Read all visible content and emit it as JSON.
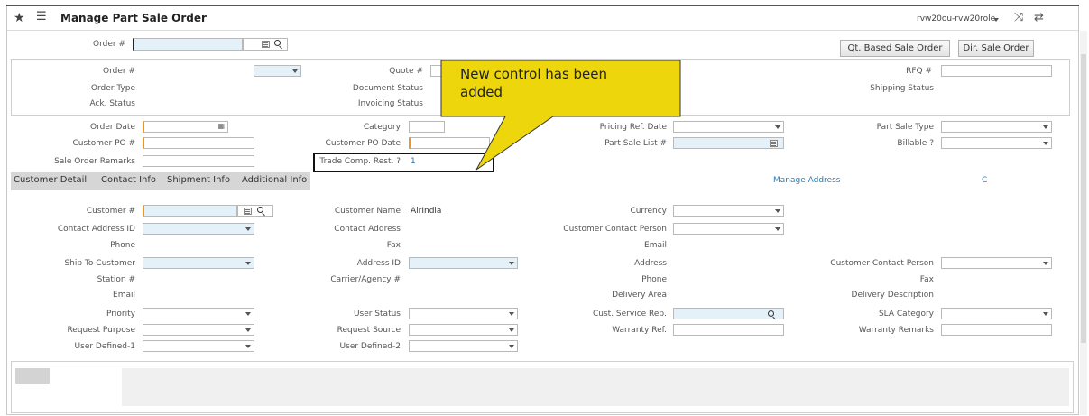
{
  "header": {
    "title": "Manage Part Sale Order",
    "user_role": "rvw20ou-rvw20role"
  },
  "toolbar": {
    "order_label": "Order #",
    "qt_button": "Qt. Based Sale Order",
    "dir_button": "Dir. Sale Order"
  },
  "status_panel": {
    "order_label": "Order #",
    "quote_label": "Quote #",
    "rfq_label": "RFQ #",
    "order_type_label": "Order Type",
    "doc_status_label": "Document Status",
    "shipping_status_label": "Shipping Status",
    "ack_status_label": "Ack. Status",
    "invoicing_status_label": "Invoicing Status"
  },
  "callout": {
    "text_line1": "New control has been",
    "text_line2": "added"
  },
  "order_form": {
    "order_date_label": "Order Date",
    "category_label": "Category",
    "pricing_ref_date_label": "Pricing Ref. Date",
    "part_sale_type_label": "Part Sale Type",
    "customer_po_label": "Customer PO #",
    "customer_po_date_label": "Customer PO Date",
    "part_sale_list_label": "Part Sale List #",
    "billable_label": "Billable ?",
    "remarks_label": "Sale Order Remarks",
    "trade_comp_label": "Trade Comp. Rest. ?",
    "trade_comp_value": "1"
  },
  "tabs": [
    "Customer Detail",
    "Contact Info",
    "Shipment Info",
    "Additional Info"
  ],
  "links": {
    "manage_address": "Manage Address",
    "c": "C"
  },
  "customer": {
    "customer_label": "Customer #",
    "customer_name_label": "Customer Name",
    "customer_name_value": "AirIndia",
    "currency_label": "Currency",
    "contact_address_id_label": "Contact Address ID",
    "contact_address_label": "Contact Address",
    "customer_contact_person_label": "Customer Contact Person",
    "phone_label": "Phone",
    "fax_label": "Fax",
    "email_label": "Email",
    "ship_to_customer_label": "Ship To Customer",
    "address_id_label": "Address ID",
    "address_label": "Address",
    "customer_contact_person2_label": "Customer Contact Person",
    "station_label": "Station #",
    "carrier_label": "Carrier/Agency #",
    "phone2_label": "Phone",
    "fax2_label": "Fax",
    "email2_label": "Email",
    "delivery_area_label": "Delivery Area",
    "delivery_description_label": "Delivery Description",
    "priority_label": "Priority",
    "user_status_label": "User Status",
    "cust_service_rep_label": "Cust. Service Rep.",
    "sla_category_label": "SLA Category",
    "request_purpose_label": "Request Purpose",
    "request_source_label": "Request Source",
    "warranty_ref_label": "Warranty Ref.",
    "warranty_remarks_label": "Warranty Remarks",
    "user_defined_1_label": "User Defined-1",
    "user_defined_2_label": "User Defined-2"
  },
  "colors": {
    "accent_border": "#e8962a",
    "callout_fill": "#eed60c",
    "link": "#2a7ab0",
    "input_blue": "#e5f1f8"
  }
}
